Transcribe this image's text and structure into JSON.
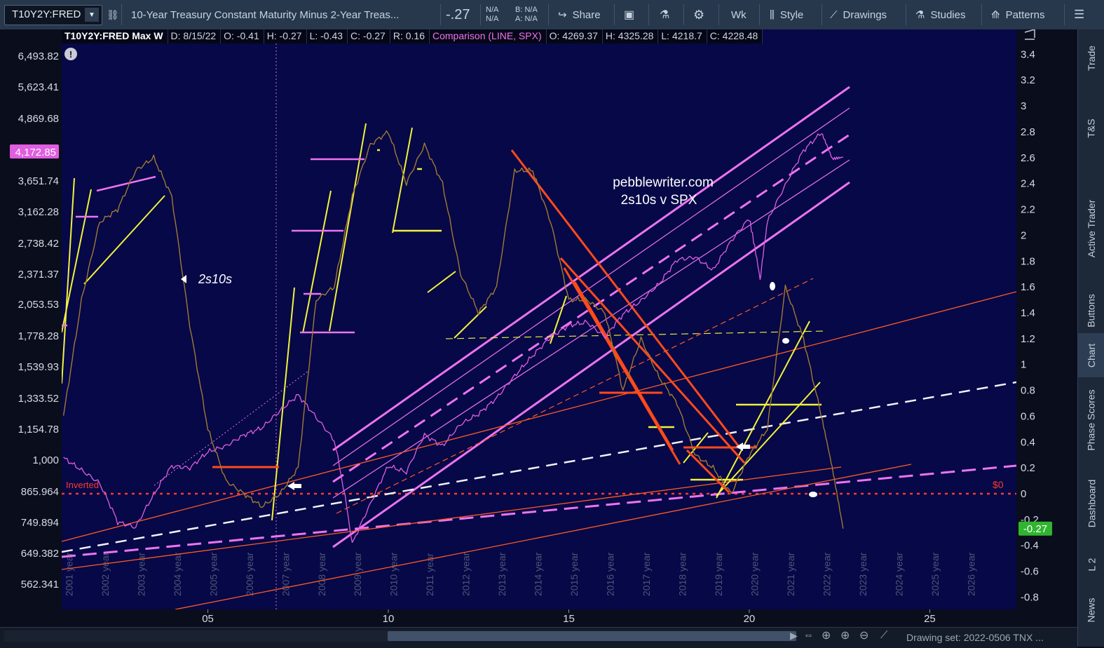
{
  "toolbar": {
    "symbol": "T10Y2Y:FRED",
    "description": "10-Year Treasury Constant Maturity Minus 2-Year Treas...",
    "last": "-.27",
    "bid_na": "N/A",
    "ask_na": "N/A",
    "b_label": "B: N/A",
    "a_label": "A: N/A",
    "share": "Share",
    "interval": "Wk",
    "style": "Style",
    "drawings": "Drawings",
    "studies": "Studies",
    "patterns": "Patterns"
  },
  "legend": {
    "symbol_period": "T10Y2Y:FRED Max W",
    "date": "D: 8/15/22",
    "open": "O: -0.41",
    "high": "H: -0.27",
    "low": "L: -0.43",
    "close": "C: -0.27",
    "range": "R: 0.16",
    "comparison": "Comparison (LINE, SPX)",
    "cmp_open": "O: 4269.37",
    "cmp_high": "H: 4325.28",
    "cmp_low": "L: 4218.7",
    "cmp_close": "C: 4228.48"
  },
  "annotations": {
    "site": "pebblewriter.com",
    "subtitle": "2s10s v SPX",
    "series_label": "2s10s",
    "inverted": "Inverted",
    "zero_label": "$0"
  },
  "chart_data": {
    "type": "line",
    "series": [
      {
        "name": "T10Y2Y:FRED",
        "axis": "right",
        "color": "#3ec13e",
        "points": [
          [
            2001.0,
            0.6
          ],
          [
            2001.5,
            1.5
          ],
          [
            2002.0,
            2.1
          ],
          [
            2002.5,
            2.2
          ],
          [
            2003.0,
            2.5
          ],
          [
            2003.5,
            2.6
          ],
          [
            2004.0,
            2.3
          ],
          [
            2004.5,
            1.3
          ],
          [
            2005.0,
            0.5
          ],
          [
            2005.5,
            0.1
          ],
          [
            2006.0,
            0.0
          ],
          [
            2006.5,
            -0.1
          ],
          [
            2007.0,
            0.0
          ],
          [
            2007.5,
            0.2
          ],
          [
            2008.0,
            1.5
          ],
          [
            2008.5,
            1.6
          ],
          [
            2009.0,
            2.3
          ],
          [
            2009.5,
            2.7
          ],
          [
            2010.0,
            2.8
          ],
          [
            2010.5,
            2.4
          ],
          [
            2011.0,
            2.7
          ],
          [
            2011.5,
            2.4
          ],
          [
            2012.0,
            1.7
          ],
          [
            2012.5,
            1.4
          ],
          [
            2013.0,
            1.6
          ],
          [
            2013.5,
            2.5
          ],
          [
            2014.0,
            2.5
          ],
          [
            2014.5,
            2.1
          ],
          [
            2015.0,
            1.5
          ],
          [
            2015.5,
            1.5
          ],
          [
            2016.0,
            1.4
          ],
          [
            2016.5,
            0.8
          ],
          [
            2017.0,
            1.2
          ],
          [
            2017.5,
            0.9
          ],
          [
            2018.0,
            0.7
          ],
          [
            2018.5,
            0.3
          ],
          [
            2019.0,
            0.2
          ],
          [
            2019.5,
            0.0
          ],
          [
            2020.0,
            0.3
          ],
          [
            2020.5,
            0.5
          ],
          [
            2021.0,
            1.6
          ],
          [
            2021.5,
            1.2
          ],
          [
            2022.0,
            0.6
          ],
          [
            2022.3,
            0.2
          ],
          [
            2022.6,
            -0.27
          ]
        ]
      },
      {
        "name": "SPX",
        "axis": "left",
        "color": "#e05ee0",
        "points": [
          [
            2001.0,
            1160
          ],
          [
            2001.5,
            1100
          ],
          [
            2002.0,
            1040
          ],
          [
            2002.5,
            880
          ],
          [
            2003.0,
            860
          ],
          [
            2003.5,
            990
          ],
          [
            2004.0,
            1120
          ],
          [
            2004.5,
            1110
          ],
          [
            2005.0,
            1190
          ],
          [
            2005.5,
            1220
          ],
          [
            2006.0,
            1280
          ],
          [
            2006.5,
            1320
          ],
          [
            2007.0,
            1420
          ],
          [
            2007.5,
            1520
          ],
          [
            2008.0,
            1380
          ],
          [
            2008.5,
            1250
          ],
          [
            2009.0,
            800
          ],
          [
            2009.5,
            950
          ],
          [
            2010.0,
            1120
          ],
          [
            2010.5,
            1090
          ],
          [
            2011.0,
            1280
          ],
          [
            2011.5,
            1220
          ],
          [
            2012.0,
            1340
          ],
          [
            2012.5,
            1400
          ],
          [
            2013.0,
            1500
          ],
          [
            2013.5,
            1650
          ],
          [
            2014.0,
            1800
          ],
          [
            2014.5,
            1950
          ],
          [
            2015.0,
            2050
          ],
          [
            2015.5,
            2080
          ],
          [
            2016.0,
            1950
          ],
          [
            2016.5,
            2150
          ],
          [
            2017.0,
            2280
          ],
          [
            2017.5,
            2450
          ],
          [
            2018.0,
            2720
          ],
          [
            2018.5,
            2750
          ],
          [
            2019.0,
            2600
          ],
          [
            2019.5,
            2950
          ],
          [
            2020.0,
            3250
          ],
          [
            2020.3,
            2500
          ],
          [
            2020.5,
            3200
          ],
          [
            2021.0,
            3750
          ],
          [
            2021.5,
            4350
          ],
          [
            2022.0,
            4700
          ],
          [
            2022.3,
            4200
          ],
          [
            2022.6,
            4228.48
          ]
        ]
      }
    ],
    "x_tick_labels": [
      "05",
      "10",
      "15",
      "20",
      "25"
    ],
    "x_year_labels": [
      "2001 year",
      "2002 year",
      "2003 year",
      "2004 year",
      "2005 year",
      "2006 year",
      "2007 year",
      "2008 year",
      "2009 year",
      "2010 year",
      "2011 year",
      "2012 year",
      "2013 year",
      "2014 year",
      "2015 year",
      "2016 year",
      "2017 year",
      "2018 year",
      "2019 year",
      "2020 year",
      "2021 year",
      "2022 year",
      "2023 year",
      "2024 year",
      "2025 year",
      "2026 year"
    ],
    "left_axis_labels": [
      "6,493.82",
      "5,623.41",
      "4,869.68",
      "3,651.74",
      "3,162.28",
      "2,738.42",
      "2,371.37",
      "2,053.53",
      "1,778.28",
      "1,539.93",
      "1,333.52",
      "1,154.78",
      "1,000",
      "865.964",
      "749.894",
      "649.382",
      "562.341"
    ],
    "left_axis_highlight": "4,172.85",
    "right_axis_labels": [
      "3.4",
      "3.2",
      "3",
      "2.8",
      "2.6",
      "2.4",
      "2.2",
      "2",
      "1.8",
      "1.6",
      "1.4",
      "1.2",
      "1",
      "0.8",
      "0.6",
      "0.4",
      "0.2",
      "0",
      "-0.2",
      "-0.4",
      "-0.6",
      "-0.8"
    ],
    "right_axis_highlight": "-0.27",
    "right_range": [
      -0.8,
      3.4
    ],
    "x_range": [
      2000.95,
      2027.4
    ]
  },
  "right_tabs": [
    "Trade",
    "T&S",
    "Active Trader",
    "Buttons",
    "Chart",
    "Phase Scores",
    "Dashboard",
    "L 2",
    "News"
  ],
  "status": {
    "drawing_set": "Drawing set: 2022-0506 TNX ..."
  },
  "colors": {
    "plot_bg": "#060848",
    "price_up": "#3ec13e",
    "price_down": "#e04a2a",
    "comparison": "#e05ee0",
    "trend_yellow": "#f2f23a",
    "trend_red": "#ff4a1a",
    "trend_magenta": "#ee73ee"
  }
}
